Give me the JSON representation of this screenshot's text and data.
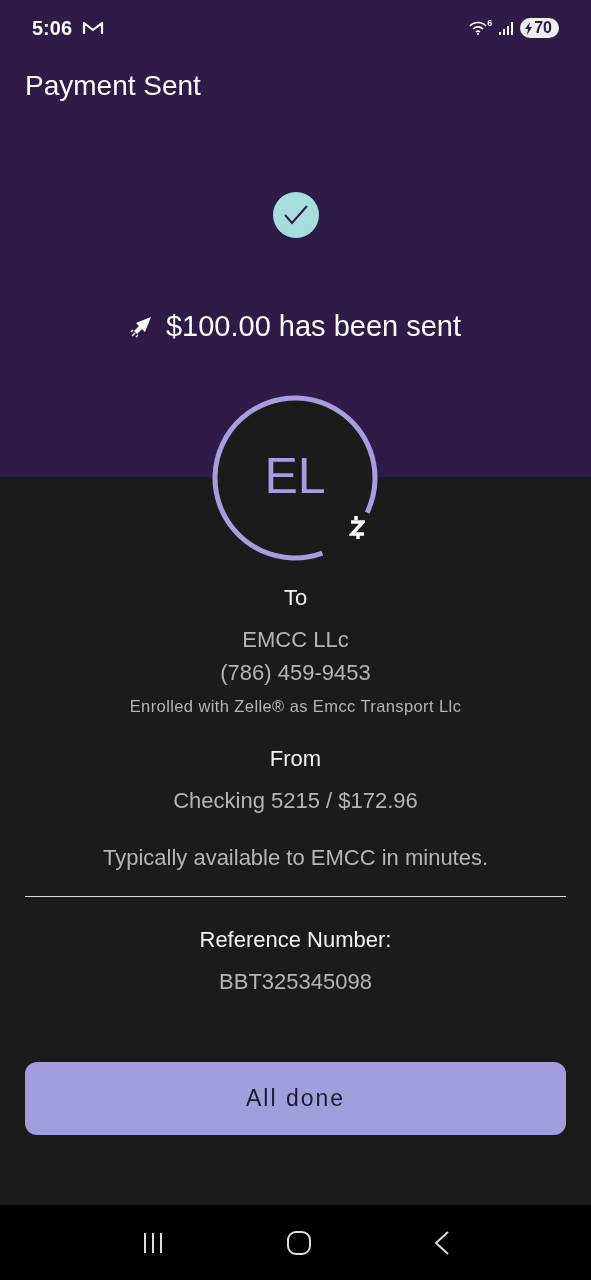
{
  "status_bar": {
    "time": "5:06",
    "network_badge": "6",
    "battery": "70"
  },
  "header": {
    "title": "Payment Sent"
  },
  "confirmation": {
    "message": "$100.00 has been sent"
  },
  "recipient": {
    "initials": "EL",
    "label": "To",
    "name": "EMCC LLc",
    "phone": "(786) 459-9453",
    "enrollment": "Enrolled with Zelle® as Emcc Transport Llc"
  },
  "source": {
    "label": "From",
    "account": "Checking 5215 / $172.96",
    "availability": "Typically available to EMCC in minutes."
  },
  "reference": {
    "label": "Reference Number:",
    "number": "BBT325345098"
  },
  "buttons": [
    {
      "label": "All done"
    }
  ]
}
